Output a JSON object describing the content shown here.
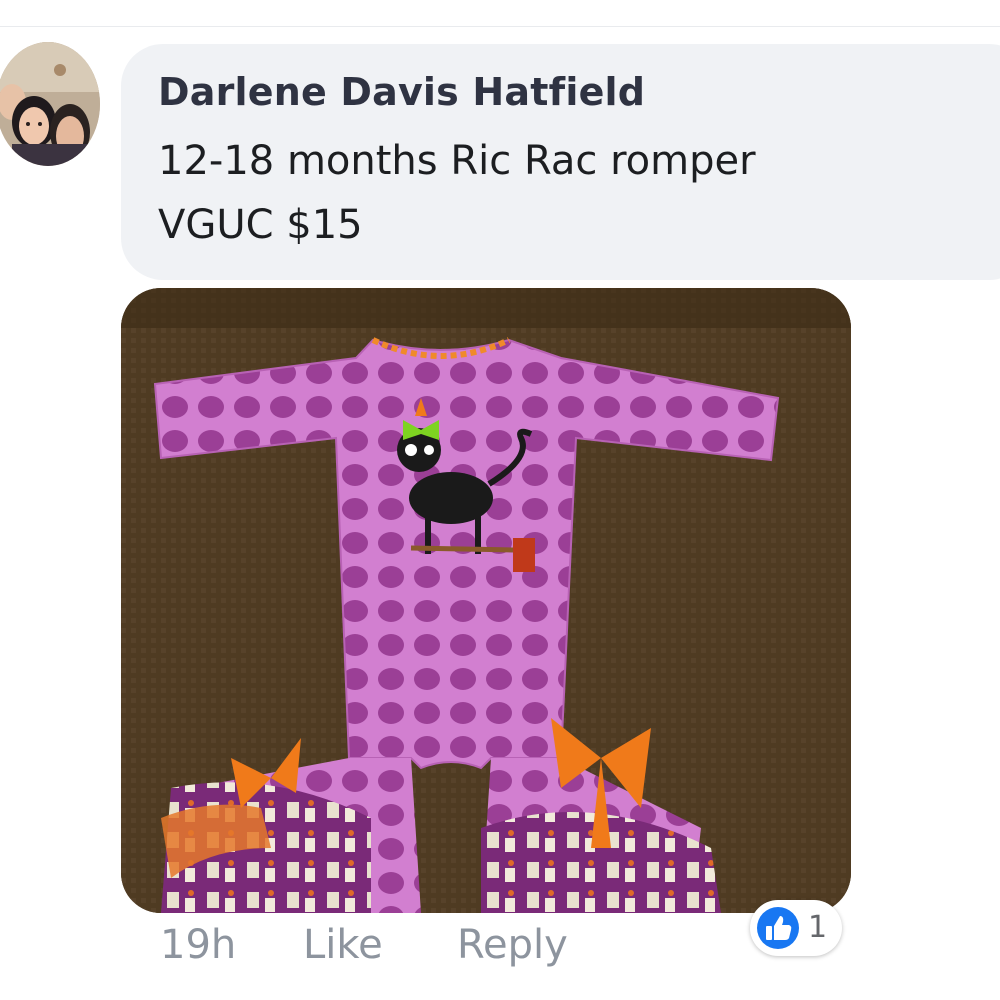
{
  "comment": {
    "author": "Darlene Davis Hatfield",
    "text_line_1": "12-18 months Ric Rac romper",
    "text_line_2": "VGUC $15",
    "timestamp": "19h",
    "like_label": "Like",
    "reply_label": "Reply",
    "reaction_count": "1",
    "reaction_icon": "thumbs-up-icon"
  },
  "colors": {
    "bubble": "#f0f2f5",
    "meta_text": "#8d949e",
    "like_blue": "#1877f2"
  }
}
